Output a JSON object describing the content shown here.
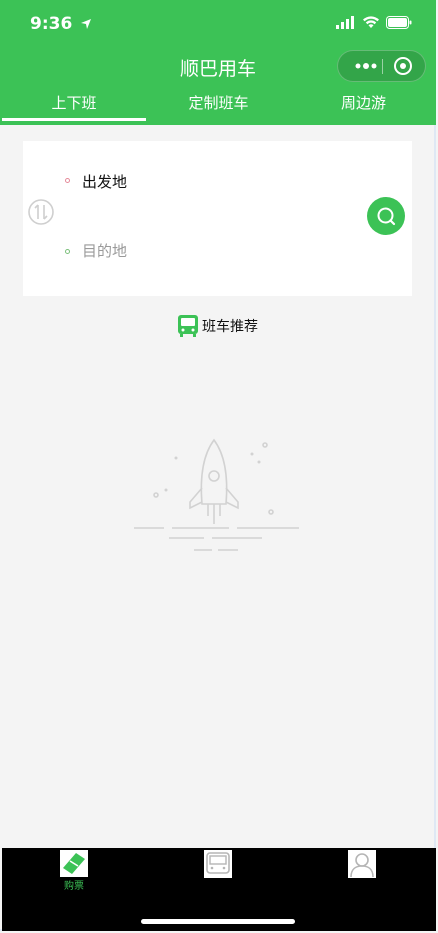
{
  "status_bar": {
    "time": "9:36"
  },
  "header": {
    "title": "顺巴用车"
  },
  "tabs": [
    {
      "label": "上下班",
      "active": true
    },
    {
      "label": "定制班车",
      "active": false
    },
    {
      "label": "周边游",
      "active": false
    }
  ],
  "route": {
    "from": "出发地",
    "to": "目的地"
  },
  "recommend": {
    "label": "班车推荐"
  },
  "bottom_nav": [
    {
      "label": "购票",
      "icon": "ticket-icon",
      "active": true
    },
    {
      "label": "",
      "icon": "bus-icon",
      "active": false
    },
    {
      "label": "",
      "icon": "person-icon",
      "active": false
    }
  ],
  "colors": {
    "brand": "#3cc256",
    "from_dot": "#e58a9a",
    "to_dot": "#7cc07c"
  }
}
